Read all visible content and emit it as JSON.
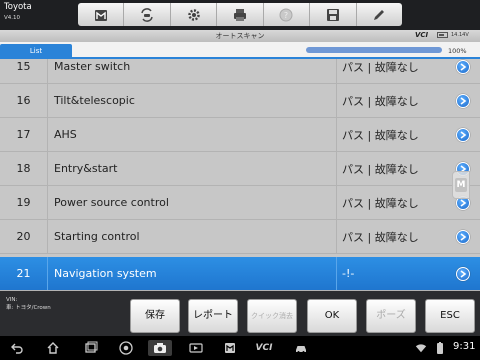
{
  "app": {
    "name": "Toyota",
    "version": "V4.10"
  },
  "toolbar": {
    "items": [
      {
        "icon": "home-icon"
      },
      {
        "icon": "vehicle-swap-icon"
      },
      {
        "icon": "settings-gear-icon"
      },
      {
        "icon": "printer-icon"
      },
      {
        "icon": "help-icon"
      },
      {
        "icon": "save-disk-icon"
      },
      {
        "icon": "edit-pencil-icon"
      }
    ]
  },
  "header": {
    "title": "オートスキャン",
    "vci_label": "VCI",
    "voltage": "14.14V"
  },
  "tabs": {
    "list_label": "List"
  },
  "progress": {
    "value": 1.0,
    "label": "100%"
  },
  "rows": [
    {
      "no": "15",
      "name": "Master switch",
      "status": "パス | 故障なし",
      "selected": false
    },
    {
      "no": "16",
      "name": "Tilt&telescopic",
      "status": "パス | 故障なし",
      "selected": false
    },
    {
      "no": "17",
      "name": "AHS",
      "status": "パス | 故障なし",
      "selected": false
    },
    {
      "no": "18",
      "name": "Entry&start",
      "status": "パス | 故障なし",
      "selected": false
    },
    {
      "no": "19",
      "name": "Power source control",
      "status": "パス | 故障なし",
      "selected": false
    },
    {
      "no": "20",
      "name": "Starting control",
      "status": "パス | 故障なし",
      "selected": false
    },
    {
      "no": "21",
      "name": "Navigation system",
      "status": "-!-",
      "selected": true
    }
  ],
  "side_handle": {
    "letter": "M"
  },
  "footer": {
    "vin_label": "VIN:",
    "vehicle": "車: トヨタ/Crown",
    "buttons": [
      {
        "label": "保存",
        "enabled": true
      },
      {
        "label": "レポート",
        "enabled": true
      },
      {
        "label": "クイック消去",
        "enabled": false
      },
      {
        "label": "OK",
        "enabled": true
      },
      {
        "label": "ポーズ",
        "enabled": false
      },
      {
        "label": "ESC",
        "enabled": true
      }
    ]
  },
  "system_bar": {
    "icons": [
      "back-icon",
      "home-icon",
      "recents-icon",
      "chrome-icon",
      "camera-icon",
      "media-icon",
      "maxisys-icon",
      "vci-icon",
      "car-icon"
    ],
    "vci_text": "VCI",
    "time": "9:31"
  },
  "colors": {
    "accent": "#2a83d8",
    "row_bg": "#c7c7c7",
    "selected_row": "#2d8fe4"
  }
}
